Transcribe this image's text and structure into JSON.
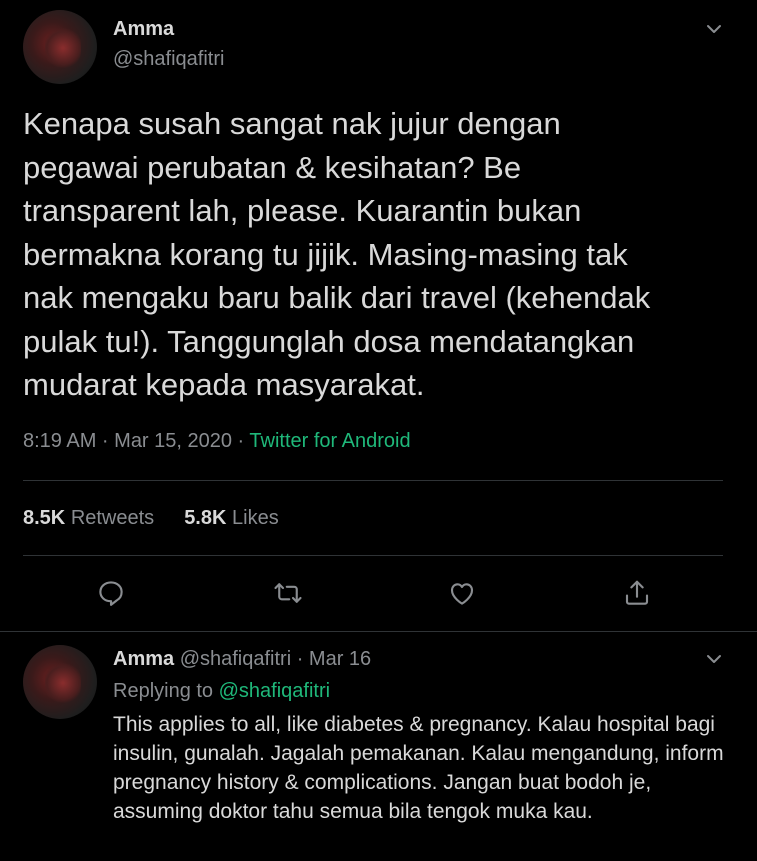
{
  "tweet": {
    "name": "Amma",
    "handle": "@shafiqafitri",
    "text": "Kenapa susah sangat nak jujur dengan\npegawai perubatan & kesihatan? Be\ntransparent lah, please. Kuarantin bukan\nbermakna korang tu jijik. Masing-masing tak\nnak mengaku baru balik dari travel (kehendak\npulak tu!). Tanggunglah dosa mendatangkan\nmudarat kepada masyarakat.",
    "time": "8:19 AM · Mar 15, 2020 · ",
    "source": "Twitter for Android",
    "retweets_count": "8.5K",
    "retweets_label": "Retweets",
    "likes_count": "5.8K",
    "likes_label": "Likes",
    "icons": [
      "reply-icon",
      "retweet-icon",
      "like-icon",
      "share-icon",
      "chevron-down-icon"
    ]
  },
  "reply": {
    "name": "Amma",
    "handle_date": "@shafiqafitri · Mar 16",
    "replying_prefix": "Replying to ",
    "replying_to": "@shafiqafitri",
    "text": "This applies to all, like diabetes & pregnancy. Kalau hospital bagi insulin, gunalah. Jagalah pemakanan. Kalau mengandung, inform pregnancy history & complications. Jangan buat bodoh je, assuming doktor tahu semua bila tengok muka kau."
  },
  "colors": {
    "background": "#000000",
    "text": "#d9d9d9",
    "secondary": "#8a8d91",
    "accent": "#1fb87a",
    "divider": "#2f3336"
  }
}
